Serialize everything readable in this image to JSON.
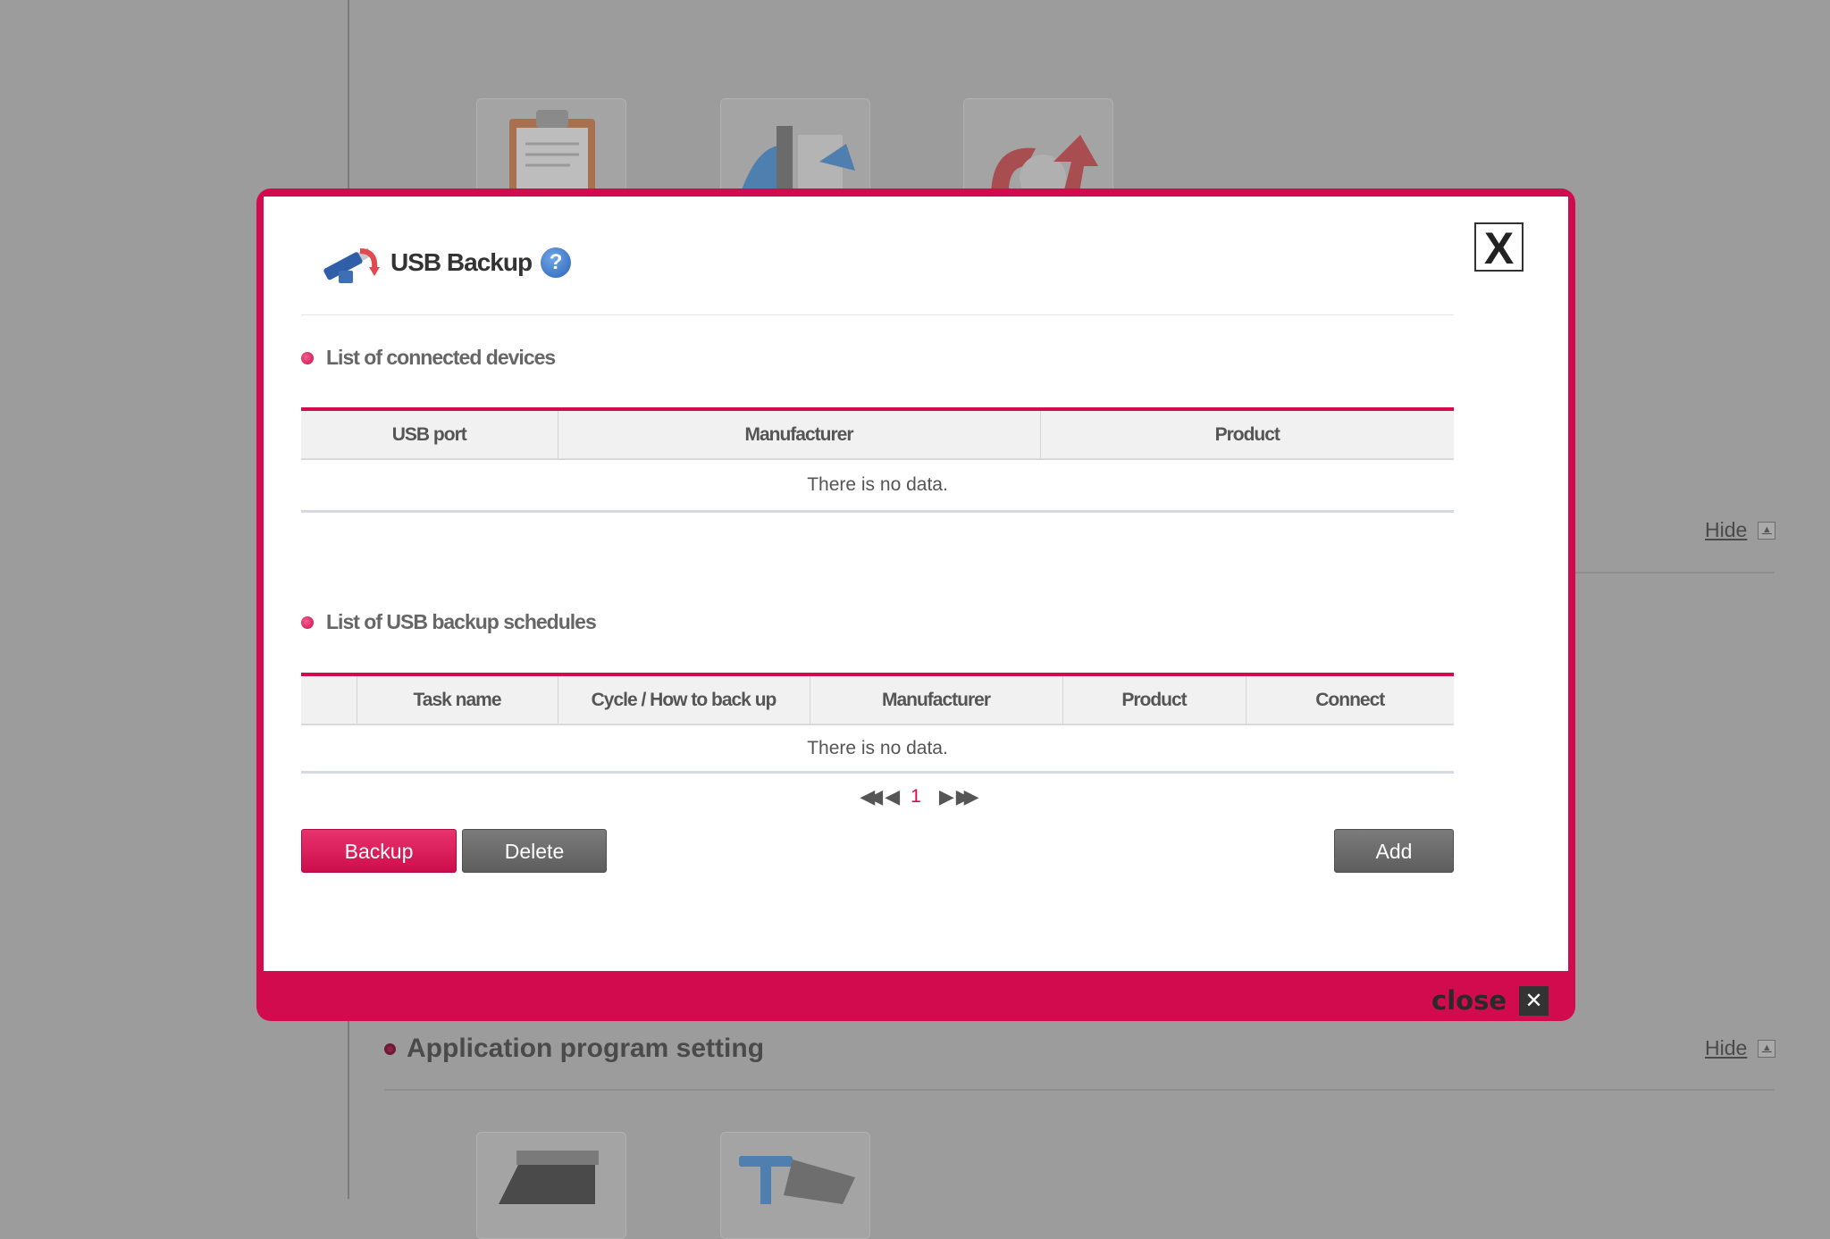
{
  "background": {
    "hide_label_1": "Hide",
    "hide_label_2": "Hide",
    "section_title": "Application program setting"
  },
  "modal": {
    "title": "USB Backup",
    "help_glyph": "?",
    "close_glyph": "X",
    "footer_close_label": "close",
    "footer_close_glyph": "✕",
    "icons": {
      "title": "usb-backup-icon",
      "help": "help-icon",
      "close": "close-icon"
    }
  },
  "devices": {
    "section_title": "List of connected devices",
    "columns": [
      "USB port",
      "Manufacturer",
      "Product"
    ],
    "empty_text": "There is no data."
  },
  "schedules": {
    "section_title": "List of USB backup schedules",
    "columns": [
      "",
      "Task name",
      "Cycle / How to back up",
      "Manufacturer",
      "Product",
      "Connect"
    ],
    "empty_text": "There is no data."
  },
  "pager": {
    "first": "◀◀",
    "prev": "◀",
    "current_page": "1",
    "next": "▶",
    "last": "▶▶"
  },
  "buttons": {
    "backup": "Backup",
    "delete": "Delete",
    "add": "Add"
  },
  "colors": {
    "accent": "#d20b4f",
    "button_gray": "#666666"
  }
}
